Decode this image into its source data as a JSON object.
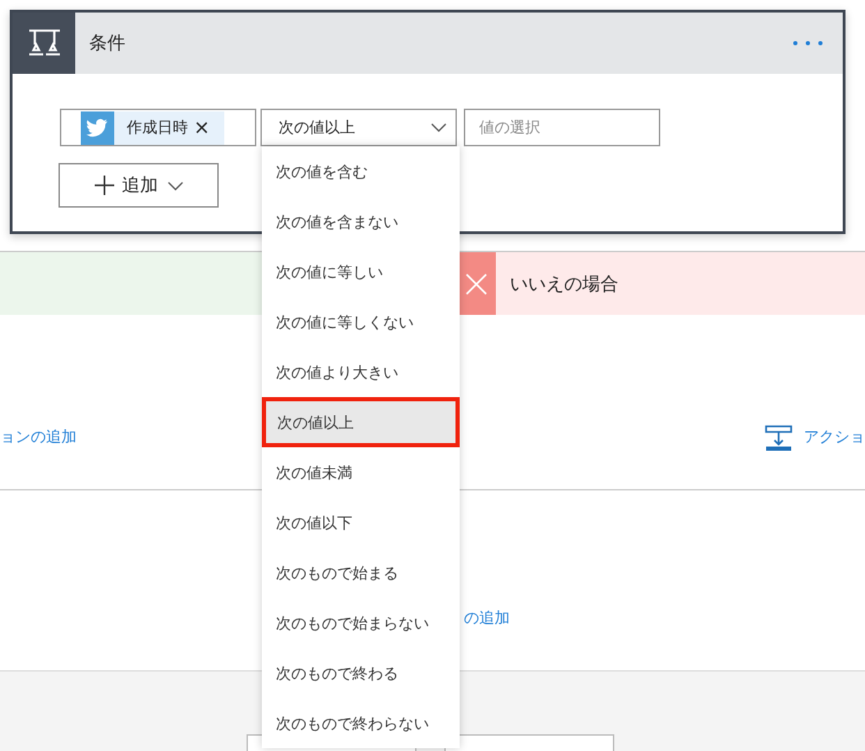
{
  "card": {
    "title": "条件",
    "condition": {
      "token": {
        "label": "作成日時",
        "remove": "×"
      },
      "operator": "次の値以上",
      "value": {
        "placeholder": "値の選択"
      }
    },
    "add_button": "追加"
  },
  "branch_no": {
    "label": "いいえの場合"
  },
  "links": [
    {
      "label": "ョンの追加"
    },
    {
      "label": "アクショ"
    },
    {
      "label": "の追加"
    }
  ],
  "dropdown": {
    "options": [
      {
        "label": "次の値を含む",
        "selected": false
      },
      {
        "label": "次の値を含まない",
        "selected": false
      },
      {
        "label": "次の値に等しい",
        "selected": false
      },
      {
        "label": "次の値に等しくない",
        "selected": false
      },
      {
        "label": "次の値より大きい",
        "selected": false
      },
      {
        "label": "次の値以上",
        "selected": true
      },
      {
        "label": "次の値未満",
        "selected": false
      },
      {
        "label": "次の値以下",
        "selected": false
      },
      {
        "label": "次のもので始まる",
        "selected": false
      },
      {
        "label": "次のもので始まらない",
        "selected": false
      },
      {
        "label": "次のもので終わる",
        "selected": false
      },
      {
        "label": "次のもので終わらない",
        "selected": false
      }
    ]
  }
}
